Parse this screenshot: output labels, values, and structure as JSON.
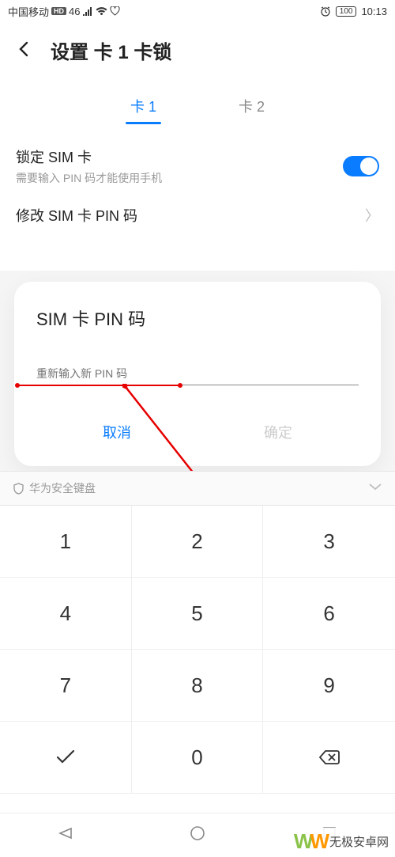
{
  "status": {
    "carrier": "中国移动",
    "badge": "HD",
    "net": "46",
    "time": "10:13",
    "batteryText": "100"
  },
  "header": {
    "title": "设置 卡 1 卡锁"
  },
  "tabs": {
    "t1": "卡 1",
    "t2": "卡 2"
  },
  "settings": {
    "lockTitle": "锁定 SIM 卡",
    "lockSub": "需要输入 PIN 码才能使用手机",
    "changePin": "修改 SIM 卡 PIN 码"
  },
  "dialog": {
    "title": "SIM 卡 PIN 码",
    "placeholder": "重新输入新 PIN 码",
    "cancel": "取消",
    "confirm": "确定"
  },
  "keyboard": {
    "label": "华为安全键盘",
    "keys": [
      "1",
      "2",
      "3",
      "4",
      "5",
      "6",
      "7",
      "8",
      "9",
      "",
      "0",
      ""
    ]
  },
  "watermark": {
    "brand": "W",
    "text": "无极安卓网"
  }
}
